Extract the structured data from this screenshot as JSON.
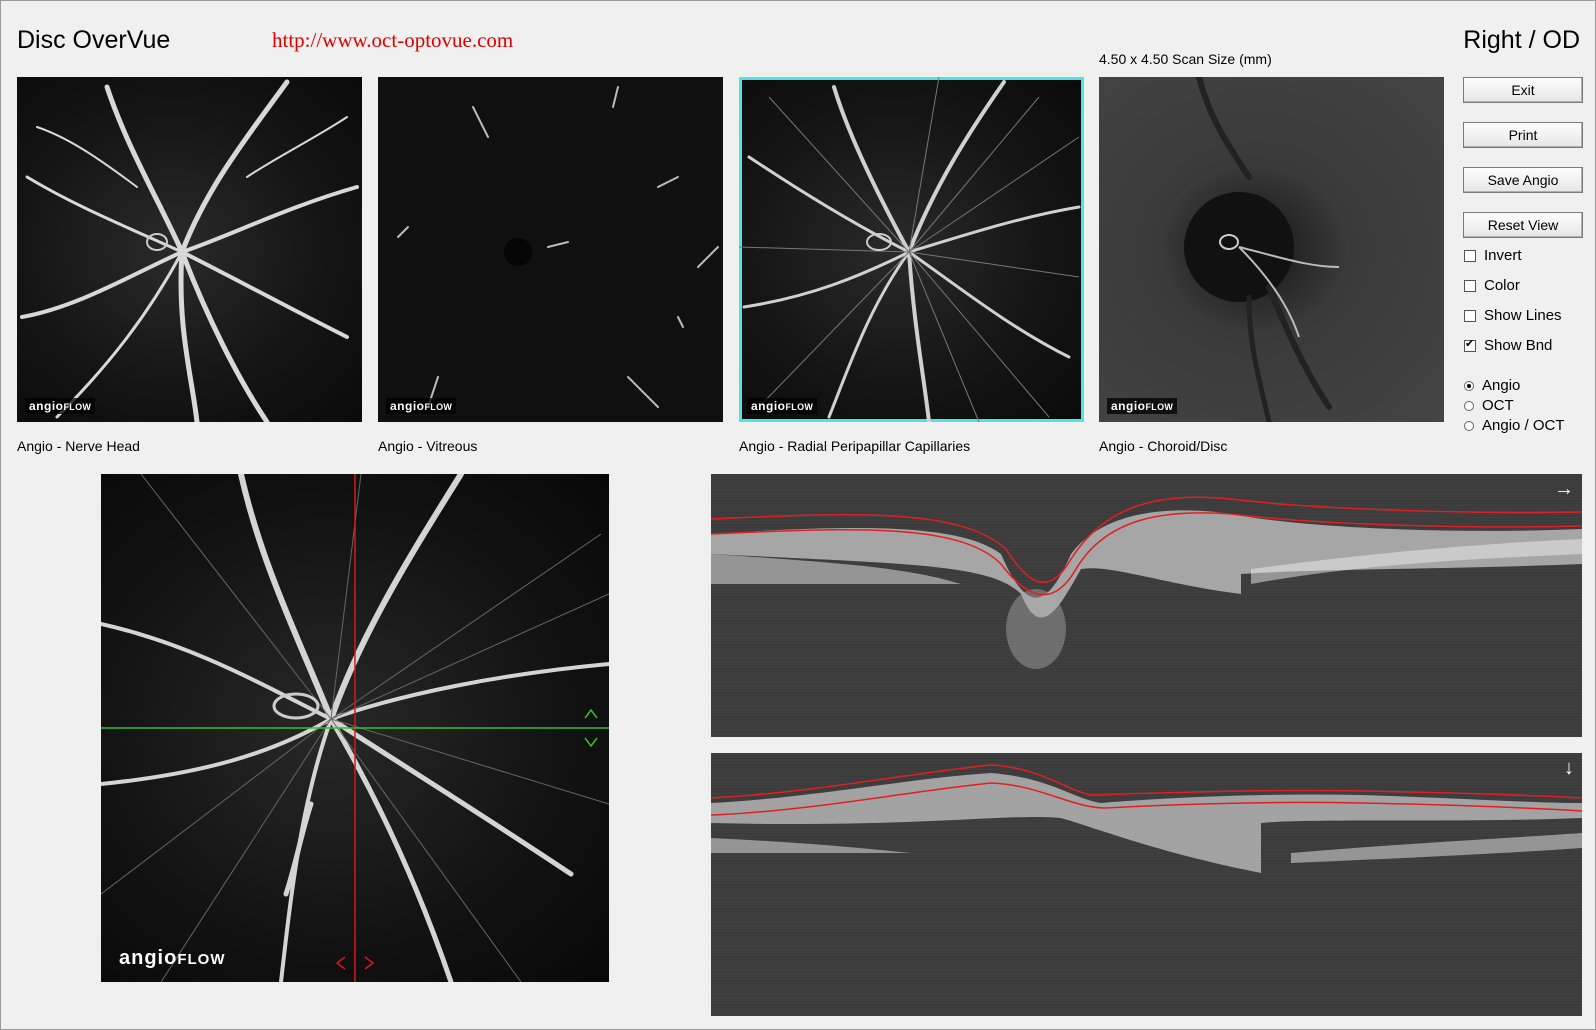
{
  "header": {
    "title": "Disc OverVue",
    "url": "http://www.oct-optovue.com",
    "eye": "Right / OD",
    "scan_size": "4.50 x 4.50 Scan Size (mm)"
  },
  "brand": {
    "main": "angio",
    "suffix": "FLOW"
  },
  "thumbnails": [
    {
      "caption": "Angio - Nerve Head",
      "selected": false
    },
    {
      "caption": "Angio - Vitreous",
      "selected": false
    },
    {
      "caption": "Angio - Radial Peripapillar Capillaries",
      "selected": true
    },
    {
      "caption": "Angio - Choroid/Disc",
      "selected": false
    }
  ],
  "buttons": {
    "exit": "Exit",
    "print": "Print",
    "save_angio": "Save Angio",
    "reset_view": "Reset View"
  },
  "checkboxes": [
    {
      "label": "Invert",
      "checked": false
    },
    {
      "label": "Color",
      "checked": false
    },
    {
      "label": "Show Lines",
      "checked": false
    },
    {
      "label": "Show Bnd",
      "checked": true
    }
  ],
  "radios": [
    {
      "label": "Angio",
      "selected": true
    },
    {
      "label": "OCT",
      "selected": false
    },
    {
      "label": "Angio / OCT",
      "selected": false
    }
  ],
  "bscan": {
    "top_marker": "→",
    "bottom_marker": "↓"
  },
  "colors": {
    "url": "#e00000",
    "selected_outline": "#4fe3e8",
    "boundary_line": "#e02020",
    "crosshair_vertical": "#d81818",
    "crosshair_horizontal": "#30c030"
  }
}
